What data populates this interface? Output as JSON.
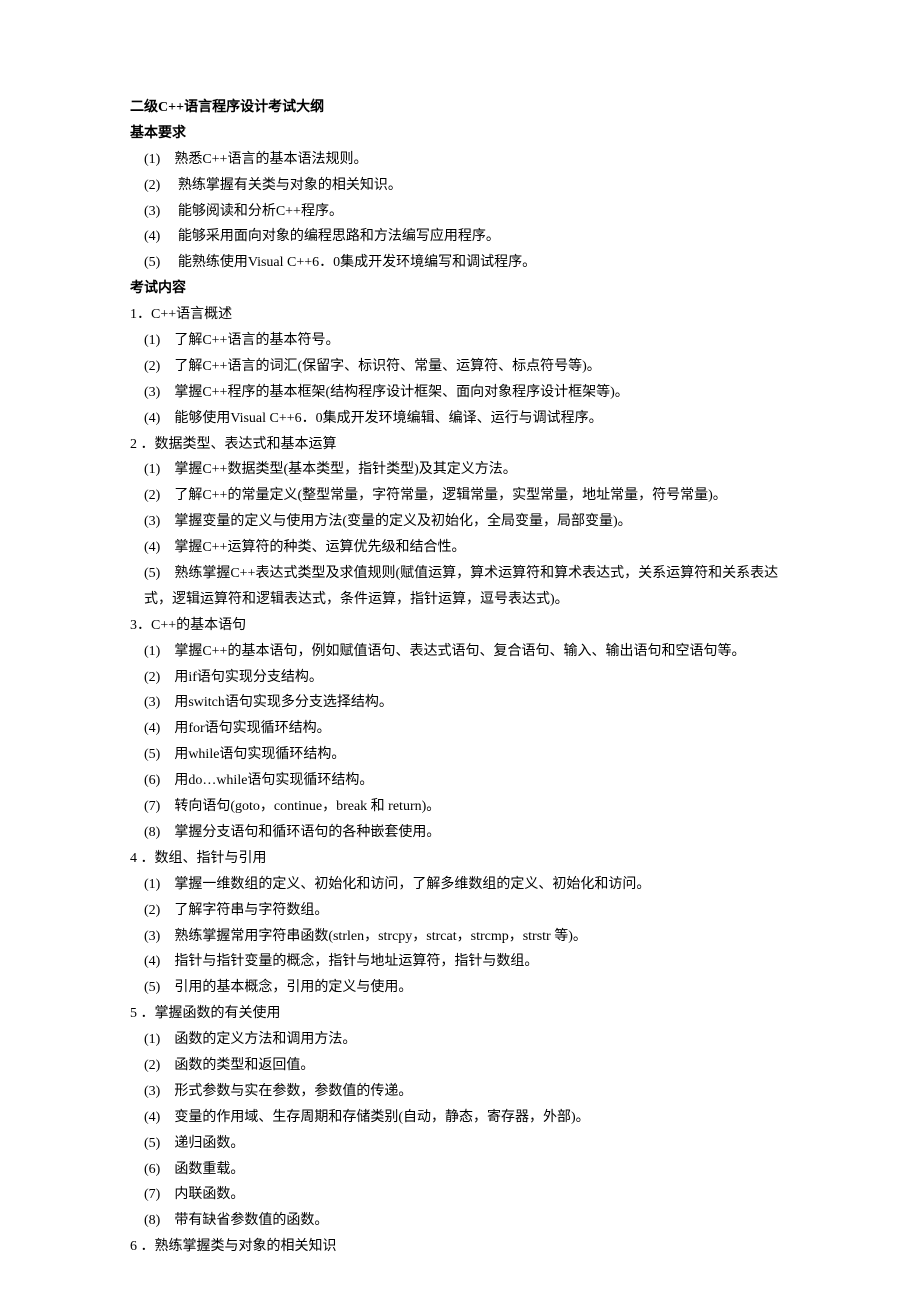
{
  "title": "二级C++语言程序设计考试大纲",
  "sections": [
    {
      "heading": "基本要求",
      "items": [
        "(1)　熟悉C++语言的基本语法规则。",
        "(2)　 熟练掌握有关类与对象的相关知识。",
        "(3)　 能够阅读和分析C++程序。",
        "(4)　 能够采用面向对象的编程思路和方法编写应用程序。",
        "(5)　 能熟练使用Visual C++6．0集成开发环境编写和调试程序。"
      ]
    },
    {
      "heading": "考试内容",
      "groups": [
        {
          "label": "1．C++语言概述",
          "items": [
            "(1)　了解C++语言的基本符号。",
            "(2)　了解C++语言的词汇(保留字、标识符、常量、运算符、标点符号等)。",
            "(3)　掌握C++程序的基本框架(结构程序设计框架、面向对象程序设计框架等)。",
            "(4)　能够使用Visual C++6．0集成开发环境编辑、编译、运行与调试程序。"
          ]
        },
        {
          "label": "2 ．数据类型、表达式和基本运算",
          "items": [
            "(1)　掌握C++数据类型(基本类型，指针类型)及其定义方法。",
            "(2)　了解C++的常量定义(整型常量，字符常量，逻辑常量，实型常量，地址常量，符号常量)。",
            "(3)　掌握变量的定义与使用方法(变量的定义及初始化，全局变量，局部变量)。",
            "(4)　掌握C++运算符的种类、运算优先级和结合性。",
            "(5)　熟练掌握C++表达式类型及求值规则(赋值运算，算术运算符和算术表达式，关系运算符和关系表达 式，逻辑运算符和逻辑表达式，条件运算，指针运算，逗号表达式)。"
          ],
          "longLast": true
        },
        {
          "label": "3．C++的基本语句",
          "items": [
            "(1)　掌握C++的基本语句，例如赋值语句、表达式语句、复合语句、输入、输出语句和空语句等。",
            "(2)　用if语句实现分支结构。",
            "(3)　用switch语句实现多分支选择结构。",
            "(4)　用for语句实现循环结构。",
            "(5)　用while语句实现循环结构。",
            "(6)　用do…while语句实现循环结构。",
            "(7)　转向语句(goto，continue，break 和 return)。",
            "(8)　掌握分支语句和循环语句的各种嵌套使用。"
          ]
        },
        {
          "label": "4 ．数组、指针与引用",
          "items": [
            "(1)　掌握一维数组的定义、初始化和访问，了解多维数组的定义、初始化和访问。",
            "(2)　了解字符串与字符数组。",
            "(3)　熟练掌握常用字符串函数(strlen，strcpy，strcat，strcmp，strstr 等)。",
            "(4)　指针与指针变量的概念，指针与地址运算符，指针与数组。",
            "(5)　引用的基本概念，引用的定义与使用。"
          ]
        },
        {
          "label": "5 ．掌握函数的有关使用",
          "items": [
            "(1)　函数的定义方法和调用方法。",
            "(2)　函数的类型和返回值。",
            "(3)　形式参数与实在参数，参数值的传递。",
            "(4)　变量的作用域、生存周期和存储类别(自动，静态，寄存器，外部)。",
            "(5)　递归函数。",
            "(6)　函数重载。",
            "(7)　内联函数。",
            "(8)　带有缺省参数值的函数。"
          ]
        },
        {
          "label": "6 ．熟练掌握类与对象的相关知识",
          "items": []
        }
      ]
    }
  ]
}
